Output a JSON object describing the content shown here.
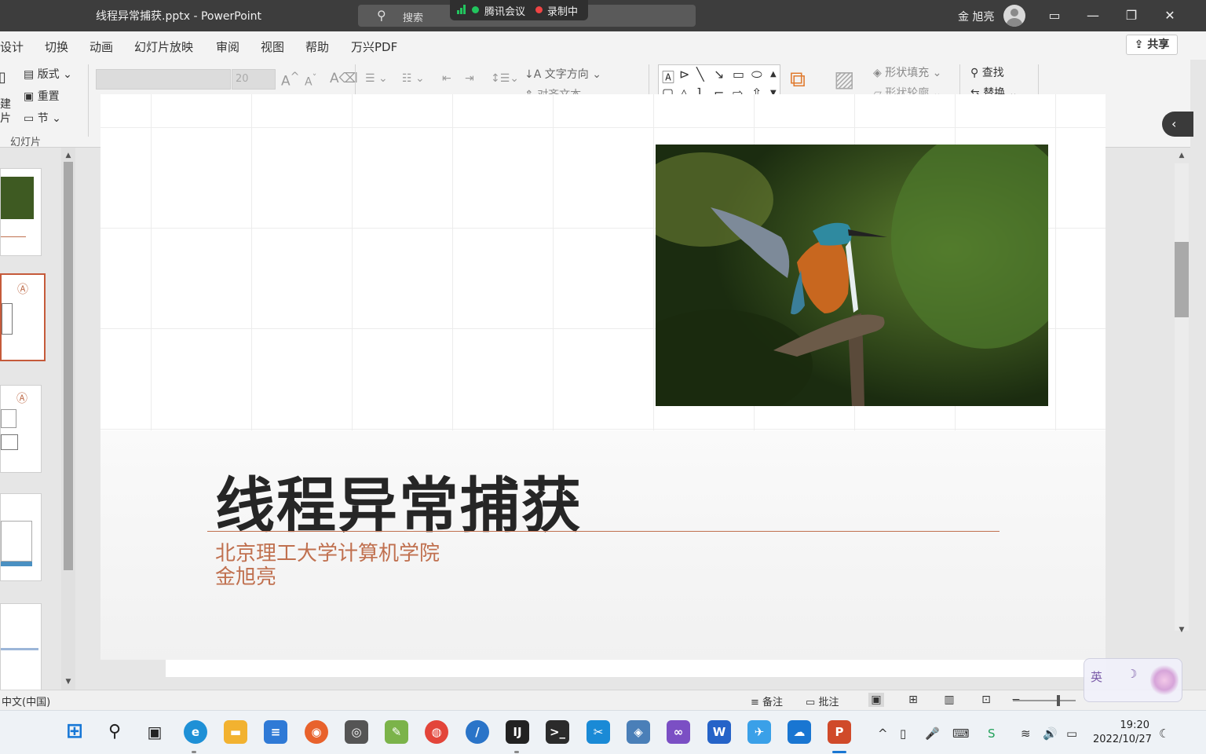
{
  "window": {
    "title": "线程异常捕获.pptx  -  PowerPoint",
    "search_placeholder": "搜索",
    "meeting_app": "腾讯会议",
    "recording": "录制中",
    "user_name": "金 旭亮",
    "share_label": "共享"
  },
  "menu": {
    "tabs": [
      "设计",
      "切换",
      "动画",
      "幻灯片放映",
      "审阅",
      "视图",
      "帮助",
      "万兴PDF"
    ]
  },
  "ribbon": {
    "slides_group": {
      "layout": "版式",
      "reset": "重置",
      "section": "节",
      "new_partial": "建",
      "slide_partial": "片",
      "group_label": "幻灯片"
    },
    "font": {
      "family_value": "",
      "size_value": "20",
      "increase": "A",
      "decrease": "A",
      "clear": "A"
    },
    "paragraph": {
      "text_direction": "文字方向",
      "align_text": "对齐文本"
    },
    "drawing": {
      "shape_fill": "形状填充",
      "shape_outline": "形状轮廓"
    },
    "editing": {
      "find": "查找",
      "replace": "替换"
    }
  },
  "slide": {
    "title": "线程异常捕获",
    "subtitle_line1": "北京理工大学计算机学院",
    "subtitle_line2": "金旭亮",
    "photo_caption": "kingfisher-photo"
  },
  "statusbar": {
    "language": "中文(中国)",
    "notes": "备注",
    "comments": "批注"
  },
  "ime": {
    "mode": "英"
  },
  "taskbar": {
    "apps": [
      "windows-start",
      "search",
      "task-view",
      "edge",
      "file-explorer",
      "notepad",
      "firefox",
      "camera",
      "paint",
      "chrome",
      "pen-app",
      "jetbrains",
      "terminal",
      "snipping",
      "network-tool",
      "visual-studio",
      "wps-docs",
      "feishu",
      "screen-share",
      "powerpoint"
    ],
    "time": "19:20",
    "date": "2022/10/27"
  },
  "colors": {
    "accent": "#c0704f",
    "titlebar": "#3d3d3d",
    "ribbon": "#f3f3f3"
  }
}
